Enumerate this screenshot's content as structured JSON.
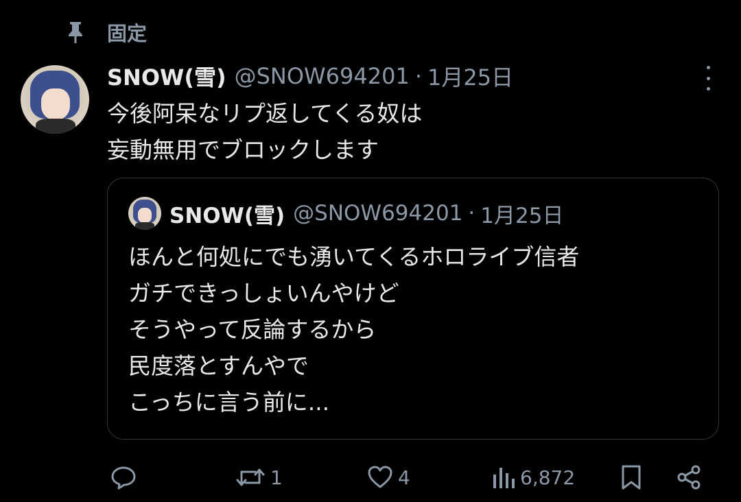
{
  "pinned": {
    "label": "固定"
  },
  "tweet": {
    "display_name": "SNOW(雪)",
    "handle": "@SNOW694201",
    "separator": "·",
    "date": "1月25日",
    "lines": [
      "今後阿呆なリプ返してくる奴は",
      "妄動無用でブロックします"
    ]
  },
  "quote": {
    "display_name": "SNOW(雪)",
    "handle": "@SNOW694201",
    "separator": "·",
    "date": "1月25日",
    "lines": [
      "ほんと何処にでも湧いてくるホロライブ信者",
      "ガチできっしょいんやけど",
      "そうやって反論するから",
      "民度落とすんやで",
      "こっちに言う前に..."
    ]
  },
  "actions": {
    "reply": {
      "icon": "reply-icon"
    },
    "retweet": {
      "icon": "retweet-icon",
      "count": "1"
    },
    "like": {
      "icon": "heart-icon",
      "count": "4"
    },
    "views": {
      "icon": "views-icon",
      "count": "6,872"
    },
    "bookmark": {
      "icon": "bookmark-icon"
    },
    "share": {
      "icon": "share-icon"
    }
  },
  "colors": {
    "background": "#000000",
    "text": "#e7e9ea",
    "muted": "#8b98a5",
    "border": "#333639"
  }
}
